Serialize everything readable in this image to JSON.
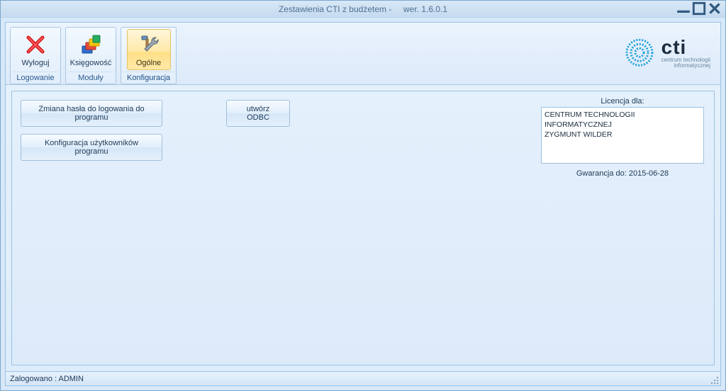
{
  "window": {
    "title_main": "Zestawienia CTI z budżetem -",
    "title_version": "wer. 1.6.0.1"
  },
  "ribbon": {
    "groups": [
      {
        "title": "Logowanie",
        "items": [
          {
            "label": "Wyloguj",
            "icon": "x-icon"
          }
        ]
      },
      {
        "title": "Moduły",
        "items": [
          {
            "label": "Księgowość",
            "icon": "stack-icon"
          }
        ]
      },
      {
        "title": "Konfiguracja",
        "items": [
          {
            "label": "Ogólne",
            "icon": "tools-icon"
          }
        ]
      }
    ]
  },
  "logo": {
    "text": "cti",
    "sub1": "centrum technologii",
    "sub2": "informatycznej"
  },
  "actions": {
    "change_password": "Zmiana hasła do logowania do programu",
    "create_odbc": "utwórz ODBC",
    "configure_users": "Konfiguracja użytkowników programu"
  },
  "license": {
    "label": "Licencja dla:",
    "text": "CENTRUM TECHNOLOGII INFORMATYCZNEJ\nZYGMUNT WILDER",
    "warranty": "Gwarancja do: 2015-06-28"
  },
  "statusbar": {
    "logged_as": "Zalogowano : ADMIN"
  }
}
